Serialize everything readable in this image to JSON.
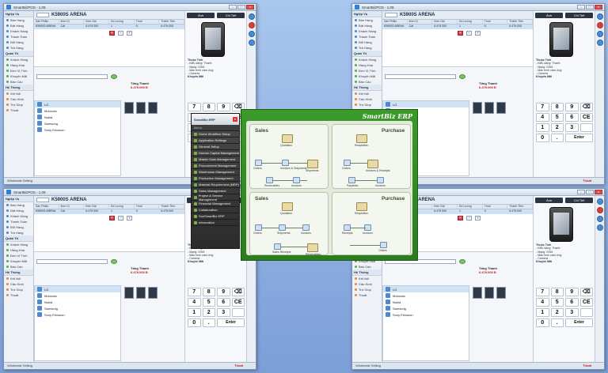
{
  "pos": {
    "window_title": "SmartBizPOS - 1.09",
    "app_title": "K5900S ARENA",
    "left_nav": {
      "section1": "Ngiệp Vụ",
      "items1": [
        "Bán Hàng",
        "Đặt Hàng",
        "Khách Hàng",
        "Thanh Toán",
        "Đổi Hàng",
        "Trả Hàng"
      ],
      "section2": "Quản Trị",
      "items2": [
        "Khách Hàng",
        "Hàng Hóa",
        "Đơn Vị Tính",
        "Khuyến Mãi",
        "Báo Cáo"
      ],
      "section3": "Hệ Thống",
      "items3": [
        "Kết Nối",
        "Cấu Hình",
        "Trợ Giúp",
        "Thoát"
      ]
    },
    "grid_headers": [
      "Sản Phẩm",
      "Đơn Vị",
      "Đơn Giá",
      "Số Lượng",
      "Thuế",
      "Thành Tiền"
    ],
    "grid_row": [
      "K5900S ARENA",
      "Cái",
      "6.479.000",
      "1",
      "0",
      "6.479.000"
    ],
    "total_label": "Tổng Thanh",
    "total_amount": "6.479.000 Đ",
    "bottom_list": [
      "LG",
      "Motorola",
      "Nokia",
      "Samsung",
      "Sony Ericsson"
    ],
    "right_tabs": [
      "Ảnh",
      "Chi Tiết"
    ],
    "specs_header": "Thuộc Tính",
    "specs": [
      "- Kiểu dáng: Thanh",
      "- Mạng: GSM",
      "- Màn hình cảm ứng",
      "- Camera"
    ],
    "promo_header": "Khuyến Mãi",
    "numpad": [
      "7",
      "8",
      "9",
      "⌫",
      "4",
      "5",
      "6",
      "CE",
      "1",
      "2",
      "3",
      "",
      "0",
      ".",
      "Enter"
    ],
    "status_text": "Wholesale Selling",
    "status_right": "Thoát"
  },
  "erp": {
    "menu_title": "SmartBiz ERP",
    "menu_header": "Menu",
    "menu_items": [
      "Home Workflow Setup",
      "Application Settings",
      "General Setup",
      "Human Capital Management",
      "Master Data Management",
      "Procurement Management",
      "Warehouse Management",
      "Production Management",
      "Material Requirement (MRP)",
      "Sales Management",
      "Project & Service Management",
      "Financial Management",
      "Collaboration",
      "SunSmartBiz ERP",
      "Information"
    ],
    "brand": "SmartBiz ERP",
    "panels": [
      {
        "title": "Sales",
        "nodes": [
          "Quotation",
          "Orders",
          "Invoices & Shipments",
          "Shipments",
          "Receivables",
          "Invoices"
        ]
      },
      {
        "title": "Purchase",
        "nodes": [
          "Requisition",
          "Orders",
          "Invoices & Receipts",
          "Invoices",
          "Payables"
        ]
      },
      {
        "title": "Sales",
        "nodes": [
          "Quotation",
          "Orders",
          "Shipments",
          "Invoices",
          "Sales Receipts",
          "Receivables"
        ]
      },
      {
        "title": "Purchase",
        "nodes": [
          "Requisition",
          "Invoices",
          "Receipts",
          "Orders"
        ]
      }
    ]
  }
}
